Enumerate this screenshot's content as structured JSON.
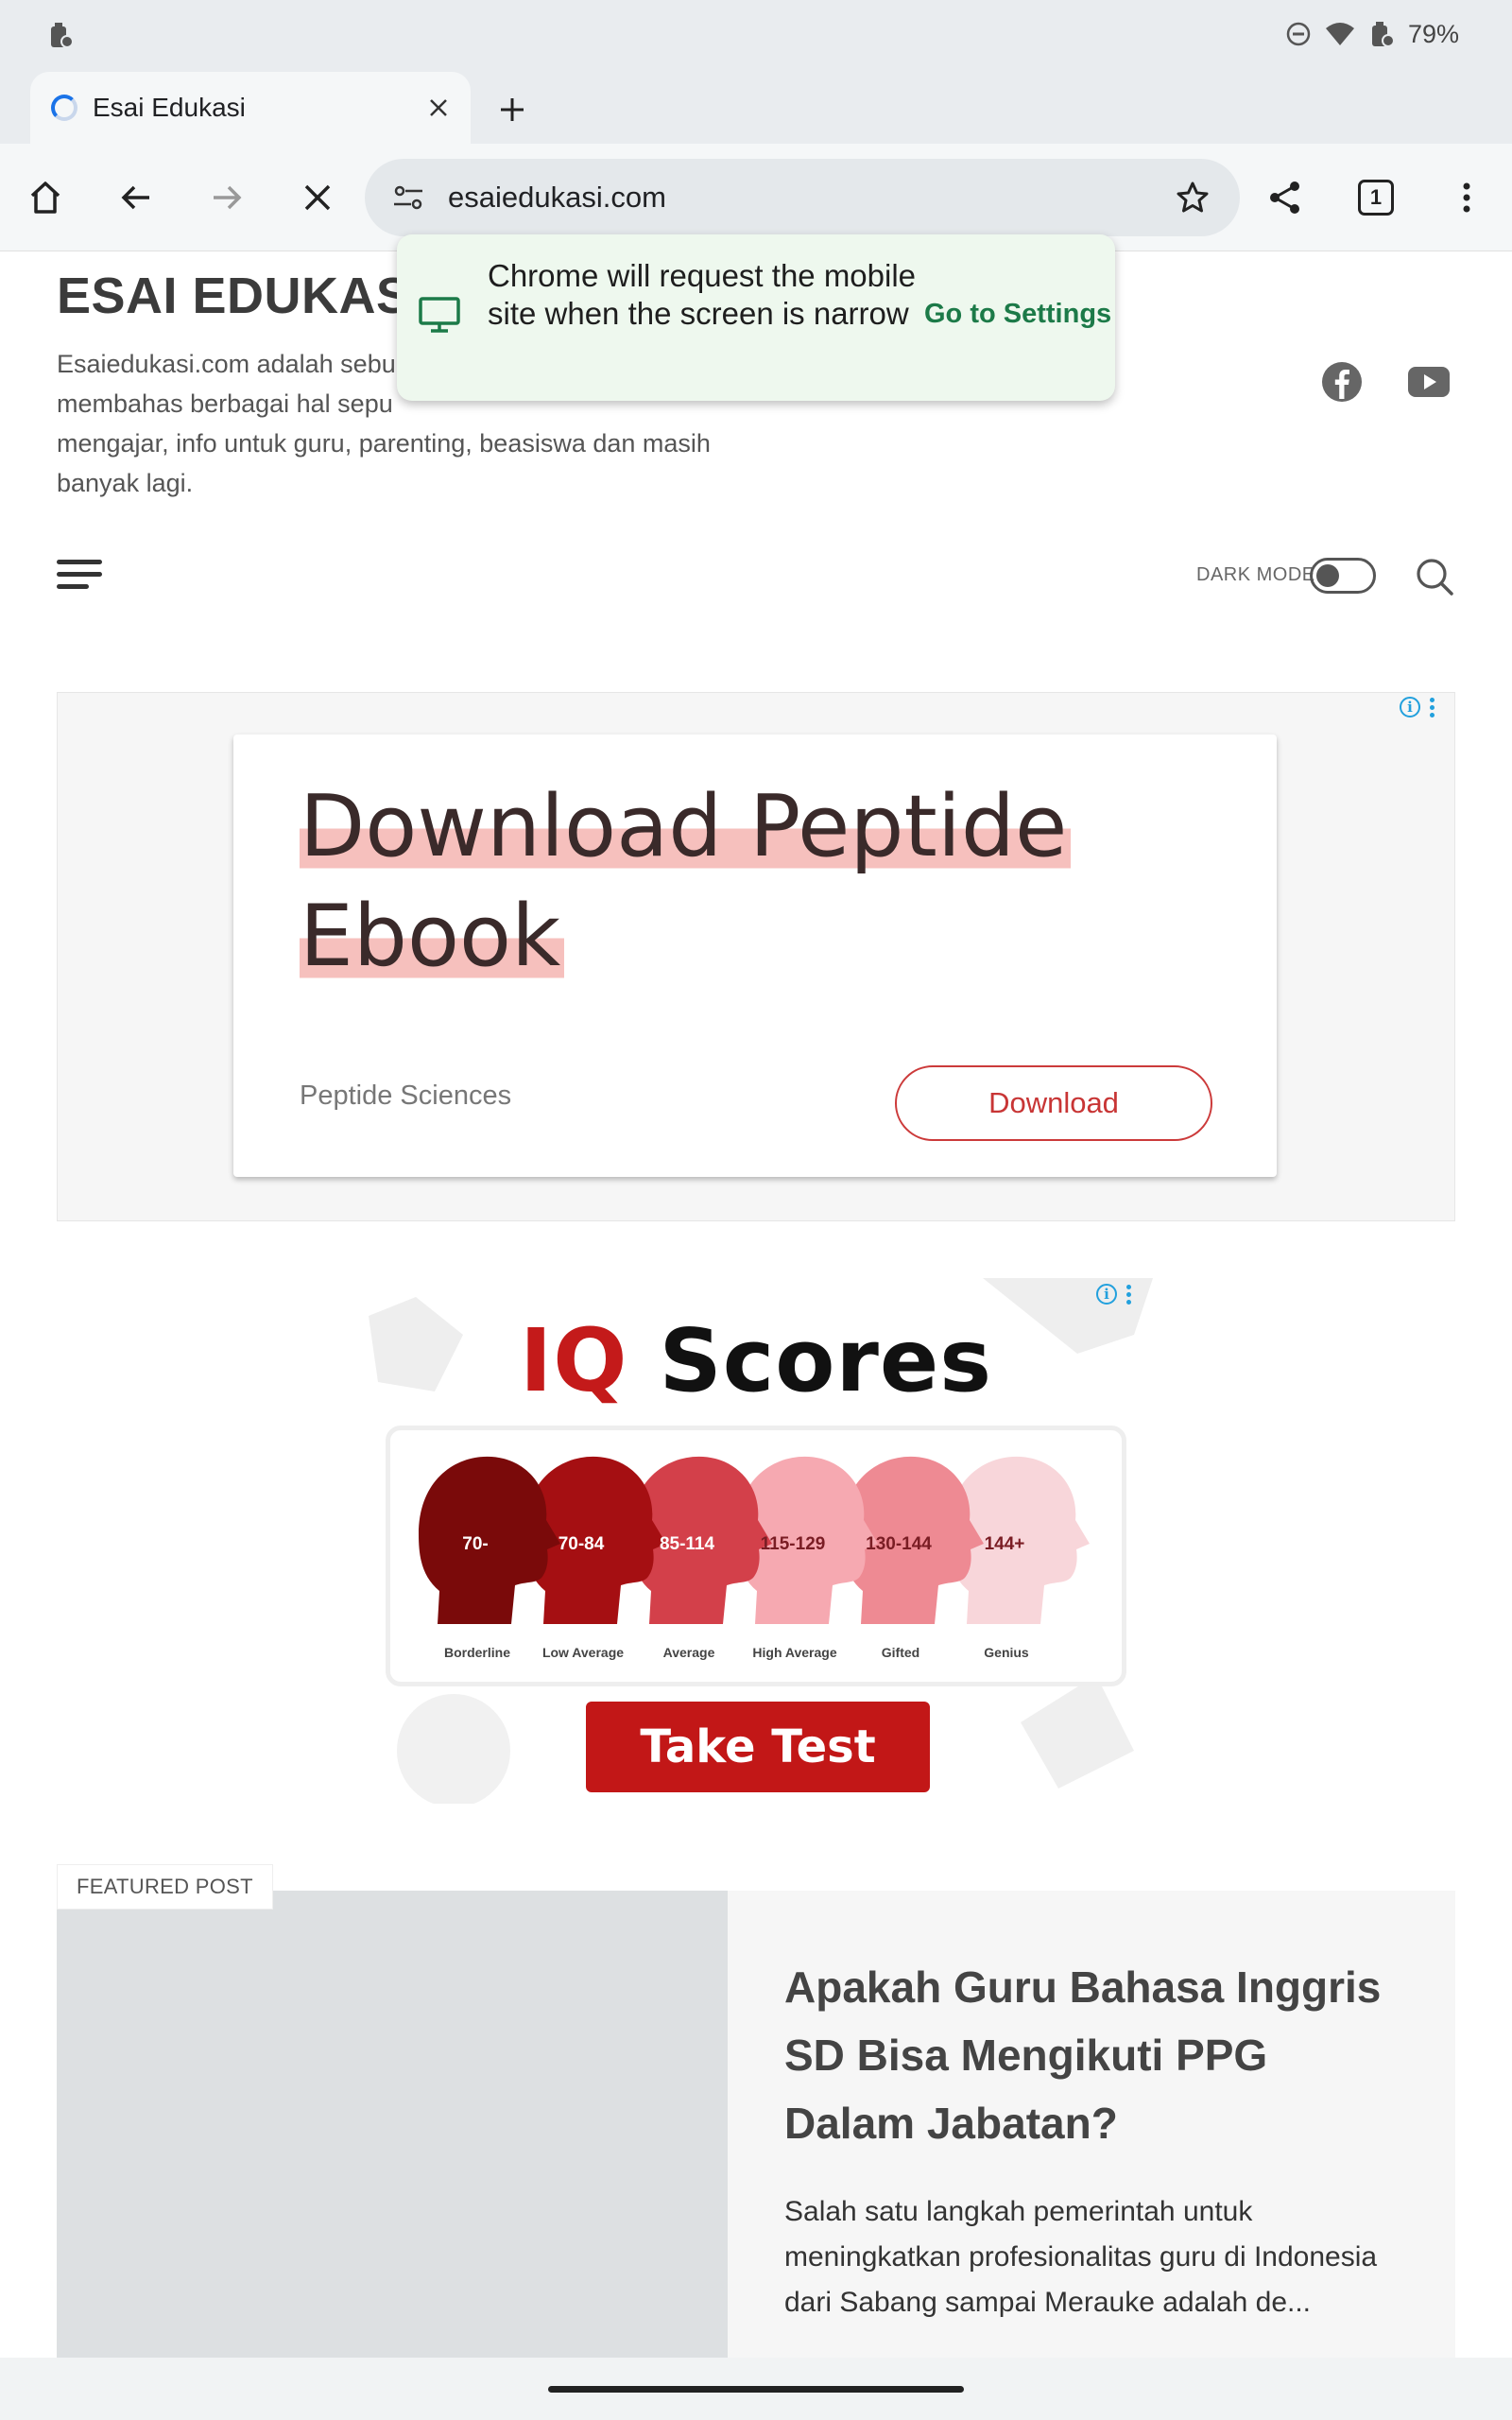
{
  "status_bar": {
    "battery": "79%",
    "icons": [
      "battery-saver-icon",
      "do-not-disturb-icon",
      "wifi-icon",
      "battery-icon"
    ]
  },
  "tab": {
    "title": "Esai Edukasi",
    "close_icon": "close-icon",
    "new_tab_icon": "plus-icon"
  },
  "toolbar": {
    "url": "esaiedukasi.com",
    "tab_count": "1",
    "icons": [
      "home-icon",
      "back-icon",
      "forward-icon",
      "stop-icon",
      "site-settings-icon",
      "star-icon",
      "share-icon",
      "tab-switcher-icon",
      "more-vert-icon"
    ]
  },
  "popup": {
    "message": "Chrome will request the mobile site when the screen is narrow",
    "action": "Go to Settings"
  },
  "site": {
    "title": "ESAI EDUKASI",
    "description": "Esaiedukasi.com adalah sebu",
    "description_2": "membahas berbagai hal sepu",
    "description_3": "mengajar, info untuk guru, parenting, beasiswa dan masih",
    "description_4": "banyak lagi.",
    "dark_mode_label": "DARK MODE",
    "social": [
      "facebook-icon",
      "youtube-icon"
    ]
  },
  "ad1": {
    "headline_1": "Download Peptide",
    "headline_2": "Ebook",
    "advertiser": "Peptide Sciences",
    "button": "Download",
    "accent": "#cc3a3a"
  },
  "ad2": {
    "title_red": "IQ",
    "title_black": " Scores",
    "ranges": [
      "70-",
      "70-84",
      "85-114",
      "115-129",
      "130-144",
      "144+"
    ],
    "categories": [
      "Borderline",
      "Low Average",
      "Average",
      "High Average",
      "Gifted",
      "Genius"
    ],
    "button": "Take Test",
    "colors": [
      "#7a0a0a",
      "#a50f12",
      "#d3404a",
      "#f6a9b1",
      "#ee8a93",
      "#f8d6da"
    ]
  },
  "featured": {
    "label": "FEATURED POST",
    "title": "Apakah Guru Bahasa Inggris SD Bisa Mengikuti PPG Dalam Jabatan?",
    "excerpt": "Salah satu langkah pemerintah untuk meningkatkan profesionalitas guru di Indonesia dari Sabang sampai Merauke adalah de..."
  }
}
